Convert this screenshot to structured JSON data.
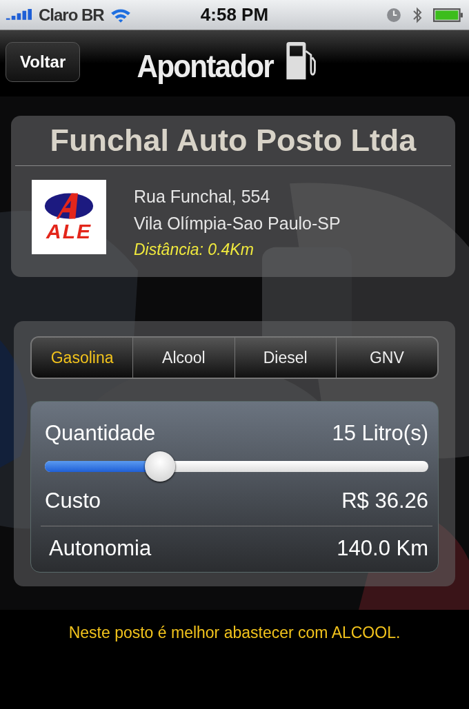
{
  "status_bar": {
    "carrier": "Claro BR",
    "time": "4:58 PM"
  },
  "nav_bar": {
    "back_button": "Voltar",
    "logo_text": "Apontador"
  },
  "station": {
    "name": "Funchal Auto Posto Ltda",
    "brand_text": "ALE",
    "address": "Rua Funchal, 554",
    "district": "Vila Olímpia-Sao Paulo-SP",
    "distance": "Distância: 0.4Km"
  },
  "fuel_tabs": [
    {
      "label": "Gasolina",
      "selected": true
    },
    {
      "label": "Alcool",
      "selected": false
    },
    {
      "label": "Diesel",
      "selected": false
    },
    {
      "label": "GNV",
      "selected": false
    }
  ],
  "calculator": {
    "quantity_label": "Quantidade",
    "quantity_value": "15 Litro(s)",
    "slider": {
      "level": 0.3
    },
    "cost_label": "Custo",
    "cost_value": "R$ 36.26",
    "range_label": "Autonomia",
    "range_value": "140.0 Km"
  },
  "recommendation": "Neste posto é melhor abastecer com ALCOOL."
}
